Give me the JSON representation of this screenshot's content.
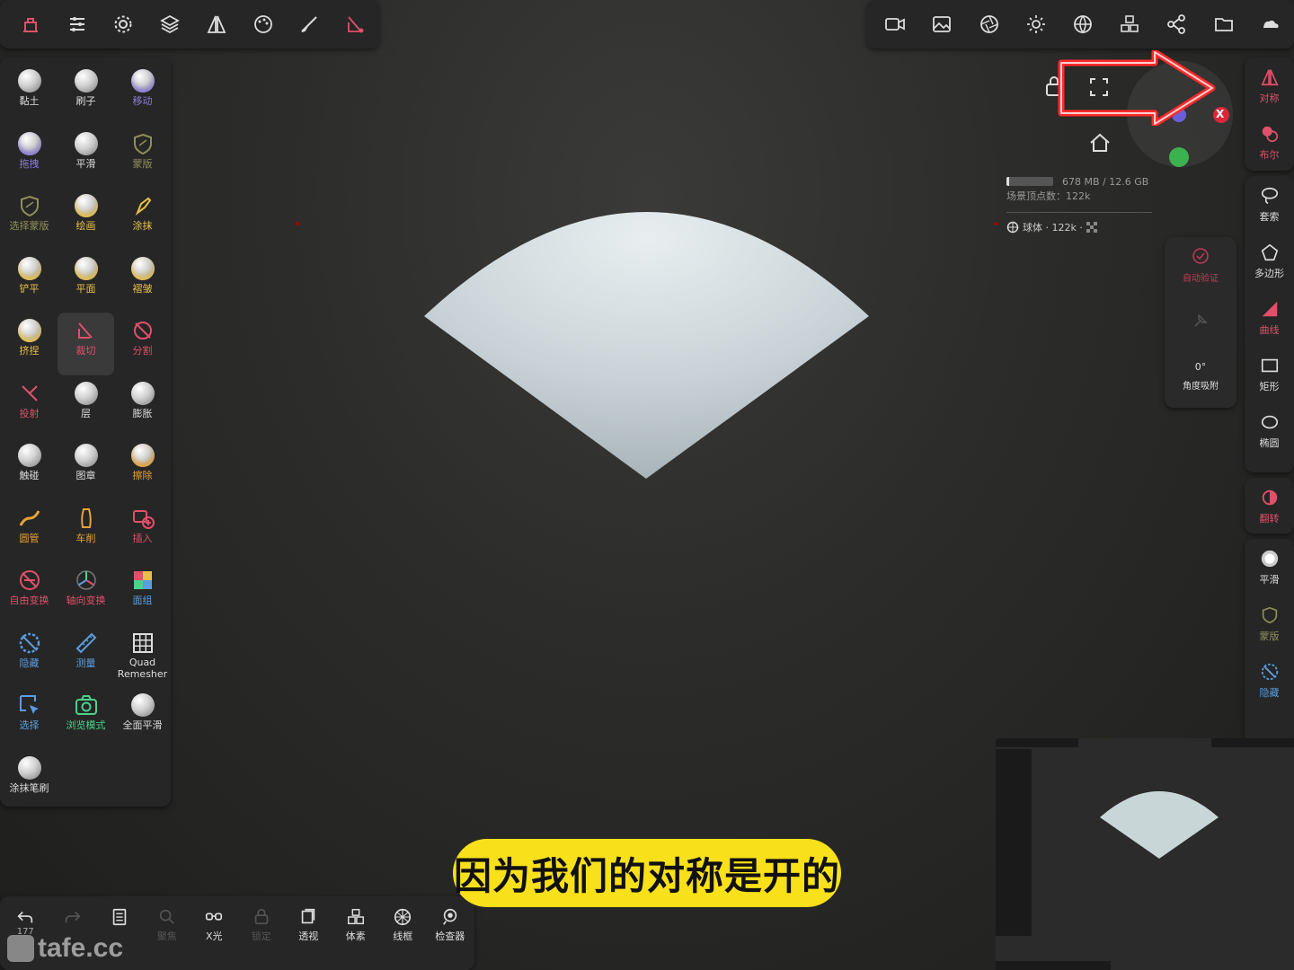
{
  "top_left_toolbar": [
    {
      "name": "scene-icon",
      "color": "#e0506a"
    },
    {
      "name": "sliders-icon",
      "color": "#ddd"
    },
    {
      "name": "gear-icon",
      "color": "#ddd"
    },
    {
      "name": "layers-icon",
      "color": "#ddd"
    },
    {
      "name": "symmetry-icon",
      "color": "#ddd"
    },
    {
      "name": "palette-icon",
      "color": "#ddd"
    },
    {
      "name": "brush-icon",
      "color": "#ddd"
    },
    {
      "name": "trim-tool-icon",
      "color": "#e0506a"
    }
  ],
  "top_right_toolbar": [
    {
      "name": "camera-icon"
    },
    {
      "name": "image-icon"
    },
    {
      "name": "aperture-icon"
    },
    {
      "name": "sun-icon"
    },
    {
      "name": "globe-icon"
    },
    {
      "name": "cubes-icon"
    },
    {
      "name": "share-icon"
    },
    {
      "name": "folder-icon"
    },
    {
      "name": "cloud-icon"
    }
  ],
  "tools": [
    {
      "label": "黏土",
      "icon": "ball",
      "color": "#eee"
    },
    {
      "label": "刷子",
      "icon": "ball",
      "color": "#eee"
    },
    {
      "label": "移动",
      "icon": "ball",
      "color": "#8a7fd8"
    },
    {
      "label": "拖拽",
      "icon": "ball",
      "color": "#8a7fd8"
    },
    {
      "label": "平滑",
      "icon": "ball",
      "color": "#eee"
    },
    {
      "label": "蒙版",
      "icon": "mask",
      "color": "#8f8f5a"
    },
    {
      "label": "选择蒙版",
      "icon": "mask",
      "color": "#8f8f5a"
    },
    {
      "label": "绘画",
      "icon": "ball",
      "color": "#e7c04a"
    },
    {
      "label": "涂抹",
      "icon": "smear",
      "color": "#e7c04a"
    },
    {
      "label": "铲平",
      "icon": "ball",
      "color": "#e7c04a"
    },
    {
      "label": "平面",
      "icon": "ball",
      "color": "#e7c04a"
    },
    {
      "label": "褶皱",
      "icon": "ball",
      "color": "#e7c04a"
    },
    {
      "label": "挤捏",
      "icon": "ball",
      "color": "#e7c04a"
    },
    {
      "label": "裁切",
      "icon": "trim",
      "color": "#e0506a"
    },
    {
      "label": "分割",
      "icon": "split",
      "color": "#e0506a"
    },
    {
      "label": "投射",
      "icon": "project",
      "color": "#e0506a"
    },
    {
      "label": "层",
      "icon": "ball",
      "color": "#eee"
    },
    {
      "label": "膨胀",
      "icon": "ball",
      "color": "#eee"
    },
    {
      "label": "触碰",
      "icon": "ball",
      "color": "#eee"
    },
    {
      "label": "图章",
      "icon": "ball",
      "color": "#eee"
    },
    {
      "label": "擦除",
      "icon": "ball",
      "color": "#e7a23a"
    },
    {
      "label": "圆管",
      "icon": "tube",
      "color": "#e7a23a"
    },
    {
      "label": "车削",
      "icon": "lathe",
      "color": "#e7a23a"
    },
    {
      "label": "插入",
      "icon": "insert",
      "color": "#e0506a"
    },
    {
      "label": "自由变换",
      "icon": "transform",
      "color": "#e0506a"
    },
    {
      "label": "轴向变换",
      "icon": "gizmo",
      "color": "#e0506a"
    },
    {
      "label": "面组",
      "icon": "facegroup",
      "color": "#5a9ee0"
    },
    {
      "label": "隐藏",
      "icon": "hide",
      "color": "#5a9ee0"
    },
    {
      "label": "测量",
      "icon": "measure",
      "color": "#5a9ee0"
    },
    {
      "label": "Quad Remesher",
      "icon": "grid",
      "color": "#ddd"
    },
    {
      "label": "选择",
      "icon": "select",
      "color": "#5a9ee0"
    },
    {
      "label": "浏览模式",
      "icon": "camera",
      "color": "#4ad28a"
    },
    {
      "label": "全面平滑",
      "icon": "ball",
      "color": "#eee"
    },
    {
      "label": "涂抹笔刷",
      "icon": "ball",
      "color": "#eee"
    }
  ],
  "right_tools_a": [
    {
      "label": "对称",
      "icon": "symmetry-icon",
      "color": "#e0506a"
    },
    {
      "label": "布尔",
      "icon": "boolean-icon",
      "color": "#e0506a"
    }
  ],
  "right_tools_b": [
    {
      "label": "套索",
      "icon": "lasso-icon",
      "color": "#ddd"
    },
    {
      "label": "多边形",
      "icon": "polygon-icon",
      "color": "#ddd"
    },
    {
      "label": "曲线",
      "icon": "curve-icon",
      "color": "#e0506a"
    },
    {
      "label": "矩形",
      "icon": "rectangle-icon",
      "color": "#ddd"
    },
    {
      "label": "椭圆",
      "icon": "ellipse-icon",
      "color": "#ddd"
    }
  ],
  "right_tools_c": [
    {
      "label": "翻转",
      "icon": "flip-icon",
      "color": "#e0506a"
    }
  ],
  "right_tools_d": [
    {
      "label": "平滑",
      "icon": "smooth-icon",
      "color": "#ddd"
    },
    {
      "label": "蒙版",
      "icon": "mask-icon",
      "color": "#8f8f5a"
    },
    {
      "label": "隐藏",
      "icon": "hide-icon",
      "color": "#5a9ee0"
    }
  ],
  "snap_panel": {
    "auto_label": "自动验证",
    "angle_value": "0°",
    "angle_label": "角度吸附"
  },
  "info": {
    "memory": "678 MB / 12.6 GB",
    "memory_fraction": 0.05,
    "vertices": "场景顶点数：122k",
    "object": "球体 · 122k ·"
  },
  "bottom_bar": [
    {
      "label": "",
      "sub": "177",
      "icon": "undo-icon",
      "color": "#ddd"
    },
    {
      "label": "",
      "sub": "",
      "icon": "redo-icon",
      "color": "#555"
    },
    {
      "label": "",
      "sub": "",
      "icon": "notes-icon",
      "color": "#ddd"
    },
    {
      "label": "聚焦",
      "sub": "",
      "icon": "search-icon",
      "color": "#555"
    },
    {
      "label": "X光",
      "sub": "",
      "icon": "xray-icon",
      "color": "#ddd"
    },
    {
      "label": "锁定",
      "sub": "",
      "icon": "lock-icon",
      "color": "#555"
    },
    {
      "label": "透视",
      "sub": "",
      "icon": "perspective-icon",
      "color": "#ddd"
    },
    {
      "label": "体素",
      "sub": "",
      "icon": "voxel-icon",
      "color": "#ddd"
    },
    {
      "label": "线框",
      "sub": "",
      "icon": "wireframe-icon",
      "color": "#ddd"
    },
    {
      "label": "检查器",
      "sub": "",
      "icon": "inspector-icon",
      "color": "#ddd"
    }
  ],
  "caption": "因为我们的对称是开的",
  "watermark": "tafe.cc",
  "gizmo": {
    "close_label": "X"
  }
}
